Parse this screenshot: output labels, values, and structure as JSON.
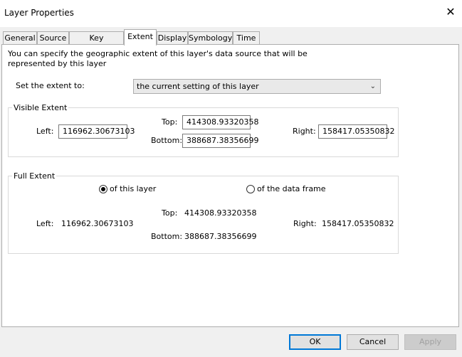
{
  "window": {
    "title": "Layer Properties"
  },
  "tabs": [
    {
      "label": "General"
    },
    {
      "label": "Source"
    },
    {
      "label": "Key Metadata"
    },
    {
      "label": "Extent"
    },
    {
      "label": "Display"
    },
    {
      "label": "Symbology"
    },
    {
      "label": "Time"
    }
  ],
  "active_tab": "Extent",
  "extent": {
    "description": "You can specify the geographic extent of this layer's data source that will be represented by this layer",
    "set_extent_label": "Set the extent to:",
    "set_extent_value": "the current setting of this layer",
    "visible_extent": {
      "title": "Visible Extent",
      "left_label": "Left:",
      "left": "116962.30673103",
      "top_label": "Top:",
      "top": "414308.93320358",
      "bottom_label": "Bottom:",
      "bottom": "388687.38356699",
      "right_label": "Right:",
      "right": "158417.05350832"
    },
    "full_extent": {
      "title": "Full Extent",
      "radio_layer": "of this layer",
      "radio_frame": "of the data frame",
      "selected": "of this layer",
      "left_label": "Left:",
      "left": "116962.30673103",
      "top_label": "Top:",
      "top": "414308.93320358",
      "bottom_label": "Bottom:",
      "bottom": "388687.38356699",
      "right_label": "Right:",
      "right": "158417.05350832"
    }
  },
  "buttons": {
    "ok": "OK",
    "cancel": "Cancel",
    "apply": "Apply"
  }
}
